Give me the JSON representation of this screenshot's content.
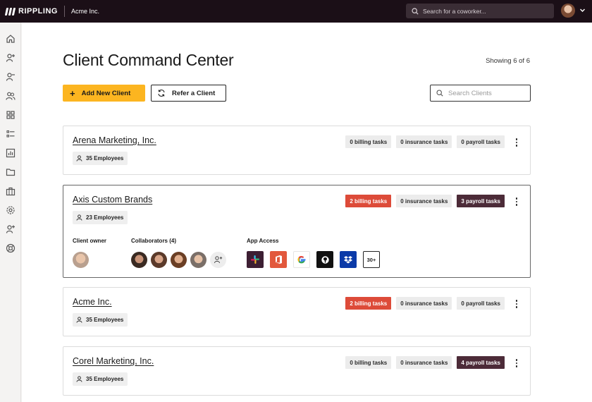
{
  "topbar": {
    "brand": "RIPPLING",
    "company": "Acme Inc.",
    "search_placeholder": "Search for a coworker..."
  },
  "sidebar": {
    "icons": [
      "home-icon",
      "add-person-icon",
      "remove-person-icon",
      "people-icon",
      "apps-grid-icon",
      "list-icon",
      "report-chart-icon",
      "folder-icon",
      "briefcase-icon",
      "settings-gear-icon",
      "invite-person-icon",
      "support-lifebuoy-icon"
    ]
  },
  "page": {
    "title": "Client Command Center",
    "showing": "Showing 6 of 6",
    "add_button": "Add New Client",
    "add_button_plus": "+",
    "refer_button": "Refer a Client",
    "search_placeholder": "Search Clients"
  },
  "clients": [
    {
      "name": "Arena Marketing, Inc.",
      "employees": "35 Employees",
      "tasks": [
        {
          "label": "0 billing tasks",
          "style": "neutral"
        },
        {
          "label": "0 insurance tasks",
          "style": "neutral"
        },
        {
          "label": "0 payroll tasks",
          "style": "neutral"
        }
      ]
    },
    {
      "name": "Axis Custom Brands",
      "employees": "23 Employees",
      "tasks": [
        {
          "label": "2 billing tasks",
          "style": "alert"
        },
        {
          "label": "0 insurance tasks",
          "style": "neutral"
        },
        {
          "label": "3 payroll tasks",
          "style": "dark"
        }
      ],
      "details": {
        "owner_label": "Client owner",
        "collaborators_label": "Collaborators (4)",
        "app_access_label": "App Access",
        "apps": [
          "slack-icon",
          "office-icon",
          "google-icon",
          "github-icon",
          "dropbox-icon"
        ],
        "more_apps": "30+"
      }
    },
    {
      "name": "Acme Inc.",
      "employees": "35 Employees",
      "tasks": [
        {
          "label": "2 billing tasks",
          "style": "alert"
        },
        {
          "label": "0 insurance tasks",
          "style": "neutral"
        },
        {
          "label": "0 payroll tasks",
          "style": "neutral"
        }
      ]
    },
    {
      "name": "Corel Marketing, Inc.",
      "employees": "35 Employees",
      "tasks": [
        {
          "label": "0 billing tasks",
          "style": "neutral"
        },
        {
          "label": "0 insurance tasks",
          "style": "neutral"
        },
        {
          "label": "4 payroll tasks",
          "style": "dark"
        }
      ]
    }
  ],
  "colors": {
    "topbar": "#1b0f17",
    "primary_button": "#fcb520",
    "alert_task": "#dd4b39",
    "dark_task": "#4c2b38"
  }
}
